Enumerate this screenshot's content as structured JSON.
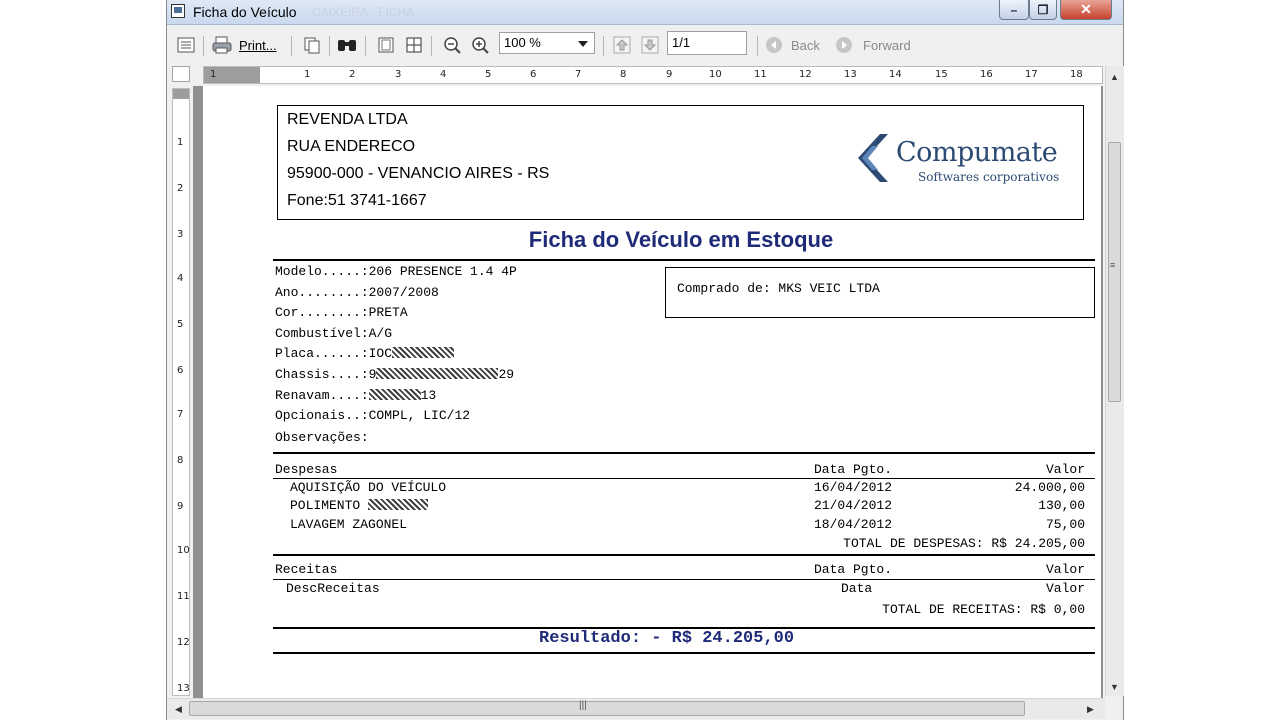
{
  "window": {
    "title": "Ficha do Veículo",
    "title_ghost": "CAIXEIRA - FICHA",
    "buttons": {
      "minimize": "–",
      "maximize": "❐",
      "close": "✕"
    }
  },
  "toolbar": {
    "print_label": "Print...",
    "zoom_value": "100 %",
    "page_value": "1/1",
    "back_label": "Back",
    "forward_label": "Forward"
  },
  "rulers": {
    "horizontal": [
      "1",
      "1",
      "2",
      "3",
      "4",
      "5",
      "6",
      "7",
      "8",
      "9",
      "10",
      "11",
      "12",
      "13",
      "14",
      "15",
      "16",
      "17",
      "18"
    ],
    "vertical": [
      "1",
      "2",
      "3",
      "4",
      "5",
      "6",
      "7",
      "8",
      "9",
      "10",
      "11",
      "12",
      "13"
    ]
  },
  "report": {
    "company": {
      "name": "REVENDA LTDA",
      "street": "RUA ENDERECO",
      "city": "95900-000 - VENANCIO AIRES - RS",
      "phone": "Fone:51 3741-1667"
    },
    "logo": {
      "name": "Compumate",
      "tagline": "Softwares corporativos"
    },
    "title": "Ficha do Veículo em Estoque",
    "vehicle": [
      {
        "label": "Modelo.....:",
        "value": "206 PRESENCE 1.4 4P"
      },
      {
        "label": "Ano........:",
        "value": "2007/2008"
      },
      {
        "label": "Cor........:",
        "value": "PRETA"
      },
      {
        "label": "Combustível:",
        "value": "A/G"
      },
      {
        "label": "Placa......:",
        "value": "IOC"
      },
      {
        "label": "Chassis....:",
        "value": "9",
        "suffix": "29"
      },
      {
        "label": "Renavam....:",
        "value": "",
        "suffix": "13"
      },
      {
        "label": "Opcionais..:",
        "value": "COMPL, LIC/12"
      },
      {
        "label": "Observações:",
        "value": ""
      }
    ],
    "buyer": "Comprado de: MKS VEIC LTDA",
    "expenses": {
      "header": {
        "desc": "Despesas",
        "date": "Data Pgto.",
        "value": "Valor"
      },
      "rows": [
        {
          "desc": "AQUISIÇÃO DO VEÍCULO",
          "date": "16/04/2012",
          "value": "24.000,00"
        },
        {
          "desc": "POLIMENTO",
          "date": "21/04/2012",
          "value": "130,00"
        },
        {
          "desc": "LAVAGEM ZAGONEL",
          "date": "18/04/2012",
          "value": "75,00"
        }
      ],
      "total": "TOTAL DE DESPESAS: R$ 24.205,00"
    },
    "revenues": {
      "header": {
        "desc": "Receitas",
        "date": "Data Pgto.",
        "value": "Valor"
      },
      "rows": [
        {
          "desc": "DescReceitas",
          "date": "Data",
          "value": "Valor"
        }
      ],
      "total": "TOTAL DE RECEITAS: R$ 0,00"
    },
    "result": "Resultado: - R$ 24.205,00"
  }
}
